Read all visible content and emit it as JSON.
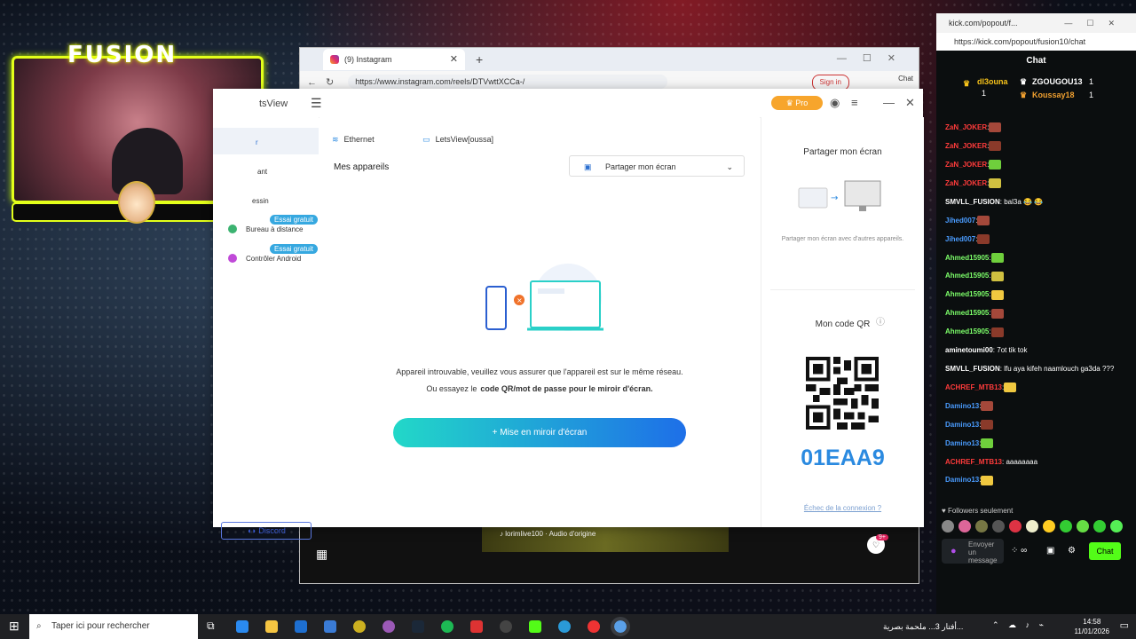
{
  "stream": {
    "logo_text": "FUSION"
  },
  "browser": {
    "tab_title": "(9) Instagram",
    "url": "https://www.instagram.com/reels/DTVwttXCCa-/",
    "signin": "Sign in",
    "copilot": "Chat",
    "music_label": "lorimlive100 · Audio d'origine",
    "notif_count": "9+"
  },
  "letsview": {
    "brand": "tsView",
    "pro": "Pro",
    "sidebar": {
      "item_r": "r",
      "item_ant": "ant",
      "item_dessin": "essin",
      "trial1": "Essai gratuit",
      "bureau": "Bureau à distance",
      "trial2": "Essai gratuit",
      "android": "Contrôler Android",
      "discord": "Discord"
    },
    "tabs": {
      "ethernet": "Ethernet",
      "device": "LetsView[oussa]"
    },
    "my_devices": "Mes appareils",
    "share_dropdown": "Partager mon écran",
    "message1": "Appareil introuvable, veuillez vous assurer que l'appareil est sur le même réseau.",
    "message2_prefix": "Ou essayez le",
    "message2_bold": "code QR/mot de passe pour le miroir d'écran.",
    "mirror_button": "+ Mise en miroir d'écran",
    "right": {
      "share_title": "Partager mon écran",
      "share_sub": "Partager mon écran avec d'autres appareils.",
      "qr_title": "Mon code QR",
      "code": "01EAA9",
      "fail_link": "Échec de la connexion ?"
    }
  },
  "chat": {
    "window_title": "kick.com/popout/f...",
    "url": "https://kick.com/popout/fusion10/chat",
    "header": "Chat",
    "leaders": {
      "first": "dl3ouna",
      "first_count": "1",
      "second": "ZGOUGOU13",
      "second_count": "1",
      "third": "Koussay18",
      "third_count": "1"
    },
    "messages": [
      {
        "user": "ZaN_JOKER",
        "text": ":",
        "color": "#ff3b3b"
      },
      {
        "user": "ZaN_JOKER",
        "text": ":",
        "color": "#ff3b3b"
      },
      {
        "user": "ZaN_JOKER",
        "text": ":",
        "color": "#ff3b3b"
      },
      {
        "user": "ZaN_JOKER",
        "text": ":",
        "color": "#ff3b3b"
      },
      {
        "user": "SMVLL_FUSION",
        "text": ": bal3a 😂 😂",
        "color": "#ffffff"
      },
      {
        "user": "Jihed007",
        "text": ":",
        "color": "#4a9cff"
      },
      {
        "user": "Jihed007",
        "text": ":",
        "color": "#4a9cff"
      },
      {
        "user": "Ahmed15905",
        "text": ":",
        "color": "#7dff6a"
      },
      {
        "user": "Ahmed15905",
        "text": ":",
        "color": "#7dff6a"
      },
      {
        "user": "Ahmed15905",
        "text": ":",
        "color": "#7dff6a"
      },
      {
        "user": "Ahmed15905",
        "text": ":",
        "color": "#7dff6a"
      },
      {
        "user": "Ahmed15905",
        "text": ":",
        "color": "#7dff6a"
      },
      {
        "user": "aminetoumi00",
        "text": ": 7ot tik tok",
        "color": "#ffffff"
      },
      {
        "user": "SMVLL_FUSION",
        "text": ": lfu aya kifeh naamlouch ga3da ???",
        "color": "#ffffff"
      },
      {
        "user": "ACHREF_MTB13",
        "text": ":",
        "color": "#ff3b3b"
      },
      {
        "user": "Damino13",
        "text": ":",
        "color": "#4a9cff"
      },
      {
        "user": "Damino13",
        "text": ":",
        "color": "#4a9cff"
      },
      {
        "user": "Damino13",
        "text": ":",
        "color": "#4a9cff"
      },
      {
        "user": "ACHREF_MTB13",
        "text": ": aaaaaaaa",
        "color": "#ff3b3b"
      },
      {
        "user": "Damino13",
        "text": ":",
        "color": "#4a9cff"
      }
    ],
    "followers_only": "♥ Followers seulement",
    "send_placeholder": "Envoyer un message",
    "chat_button": "Chat"
  },
  "taskbar": {
    "search": "Taper ici pour rechercher",
    "news": "أفتار 3... ملحمة بصرية...",
    "time": "14:58",
    "date": "11/01/2026"
  }
}
